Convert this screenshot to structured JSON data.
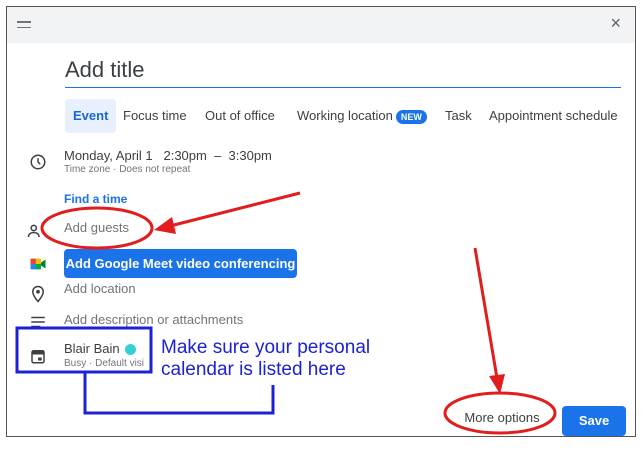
{
  "dialog": {
    "close_glyph": "×"
  },
  "title": {
    "placeholder": "Add title"
  },
  "tabs": [
    {
      "label": "Event"
    },
    {
      "label": "Focus time"
    },
    {
      "label": "Out of office"
    },
    {
      "label": "Working location",
      "badge": "NEW"
    },
    {
      "label": "Task"
    },
    {
      "label": "Appointment schedule"
    }
  ],
  "datetime": {
    "date": "Monday, April 1",
    "time": "2:30pm  –  3:30pm",
    "detail": "Time zone · Does not repeat"
  },
  "find_time": "Find a time",
  "guests": {
    "placeholder": "Add guests"
  },
  "meet_button": "Add Google Meet video conferencing",
  "location": {
    "placeholder": "Add location"
  },
  "description": {
    "placeholder": "Add description or attachments"
  },
  "calendar": {
    "name": "Blair Bain",
    "status": "Busy · Default visi",
    "dot_color": "#33d1d6"
  },
  "buttons": {
    "more_options": "More options",
    "save": "Save"
  },
  "annotation": {
    "callout_line1": "Make sure your personal",
    "callout_line2": "calendar is listed here"
  },
  "colors": {
    "accent": "#1a73e8",
    "annotation_red": "#e11d1d",
    "annotation_blue": "#1c21d6"
  },
  "icons": [
    "drag-handle-icon",
    "close-icon",
    "clock-icon",
    "people-icon",
    "meet-icon",
    "location-icon",
    "notes-icon",
    "calendar-icon"
  ]
}
